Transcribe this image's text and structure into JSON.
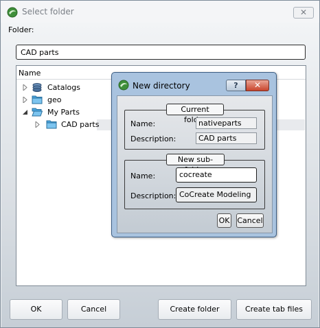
{
  "window": {
    "title": "Select folder",
    "close_glyph": "✕",
    "folder_label": "Folder:",
    "folder_value": "CAD parts"
  },
  "tree": {
    "header": "Name",
    "items": [
      {
        "label": "Catalogs",
        "icon": "catalog-icon",
        "expander": "collapsed"
      },
      {
        "label": "geo",
        "icon": "folder-icon",
        "expander": "collapsed"
      },
      {
        "label": "My Parts",
        "icon": "folder-open-icon",
        "expander": "expanded"
      },
      {
        "label": "CAD parts",
        "icon": "folder-icon",
        "expander": "collapsed",
        "selected": true
      }
    ]
  },
  "buttons": {
    "ok": "OK",
    "cancel": "Cancel",
    "create_folder": "Create folder",
    "create_tab_files": "Create tab files"
  },
  "dialog": {
    "title": "New directory",
    "help_glyph": "?",
    "close_glyph": "✕",
    "current_folder": {
      "title": "Current folder",
      "name_label": "Name:",
      "name_value": "nativeparts",
      "description_label": "Description:",
      "description_value": "CAD parts"
    },
    "new_subfolder": {
      "title": "New sub-folder",
      "name_label": "Name:",
      "name_value": "cocreate",
      "description_label": "Description:",
      "description_value": "CoCreate Modeling"
    },
    "ok": "OK",
    "cancel": "Cancel"
  },
  "colors": {
    "dialog_frame": "#a9c3df",
    "close_button": "#c9442c",
    "app_icon": "#3f8f3a"
  }
}
